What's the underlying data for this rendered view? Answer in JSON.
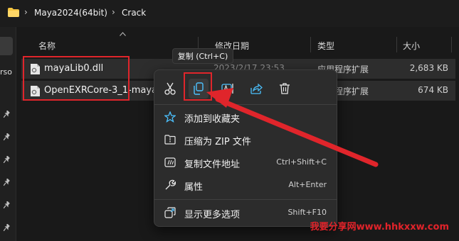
{
  "breadcrumb": {
    "items": [
      "Maya2024(64bit)",
      "Crack"
    ]
  },
  "nav": {
    "cut_text": "rso"
  },
  "columns": {
    "name": "名称",
    "modified": "修改日期",
    "type": "类型",
    "size": "大小"
  },
  "files": [
    {
      "name": "mayaLib0.dll",
      "modified": "2023/2/17 23:53",
      "type": "应用程序扩展",
      "size": "2,683 KB"
    },
    {
      "name": "OpenEXRCore-3_1-maya.dll",
      "modified": "",
      "type": "应用程序扩展",
      "size": "674 KB"
    }
  ],
  "tooltip": {
    "text": "复制 (Ctrl+C)"
  },
  "context_menu": {
    "quick_actions": [
      "cut-icon",
      "copy-icon",
      "rename-icon",
      "share-icon",
      "delete-icon"
    ],
    "items": [
      {
        "label": "添加到收藏夹",
        "shortcut": "",
        "icon": "star-icon"
      },
      {
        "label": "压缩为 ZIP 文件",
        "shortcut": "",
        "icon": "zip-icon"
      },
      {
        "label": "复制文件地址",
        "shortcut": "Ctrl+Shift+C",
        "icon": "copy-path-icon"
      },
      {
        "label": "属性",
        "shortcut": "Alt+Enter",
        "icon": "wrench-icon"
      },
      {
        "label": "显示更多选项",
        "shortcut": "Shift+F10",
        "icon": "more-options-icon"
      }
    ]
  },
  "watermark": {
    "text": "我要分享网www.hhkxxw.com"
  },
  "colors": {
    "background": "#191919",
    "menu_bg": "#2c2c2c",
    "annotation_red": "#e0252b",
    "accent_blue": "#4cc2ff"
  }
}
